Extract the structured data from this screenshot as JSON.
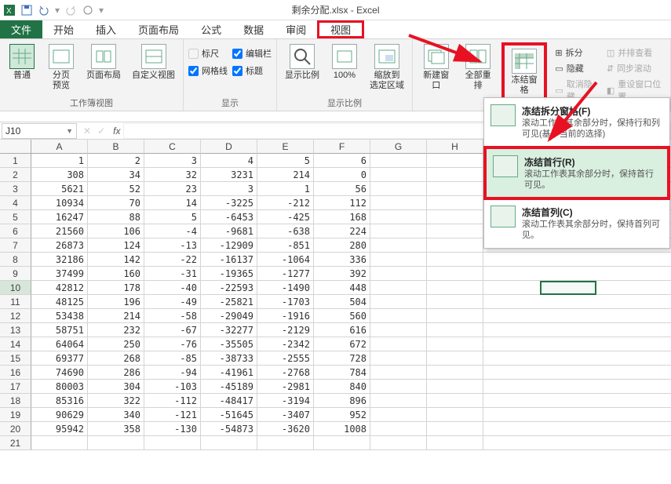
{
  "appTitle": "剩余分配.xlsx - Excel",
  "tabs": {
    "file": "文件",
    "home": "开始",
    "insert": "插入",
    "layout": "页面布局",
    "formula": "公式",
    "data": "数据",
    "review": "审阅",
    "view": "视图"
  },
  "ribbon": {
    "views": {
      "normal": "普通",
      "pagebreak": "分页\n预览",
      "pagelayout": "页面布局",
      "custom": "自定义视图",
      "groupLabel": "工作簿视图"
    },
    "show": {
      "ruler": "标尺",
      "formula": "编辑栏",
      "gridlines": "网格线",
      "headings": "标题",
      "groupLabel": "显示"
    },
    "zoom": {
      "zoom": "显示比例",
      "hundred": "100%",
      "zoomSel": "缩放到\n选定区域",
      "groupLabel": "显示比例"
    },
    "window": {
      "newWin": "新建窗口",
      "arrange": "全部重排",
      "freeze": "冻结窗格",
      "split": "拆分",
      "hide": "隐藏",
      "unhide": "取消隐藏",
      "sideBySide": "并排查看",
      "syncScroll": "同步滚动",
      "resetPos": "重设窗口位置"
    }
  },
  "freezeMenu": {
    "panes": {
      "title": "冻结拆分窗格(F)",
      "desc": "滚动工作表其余部分时，保持行和列可见(基于当前的选择)"
    },
    "topRow": {
      "title": "冻结首行(R)",
      "desc": "滚动工作表其余部分时，保持首行可见。"
    },
    "firstCol": {
      "title": "冻结首列(C)",
      "desc": "滚动工作表其余部分时，保持首列可见。"
    }
  },
  "nameBox": "J10",
  "columns": [
    "A",
    "B",
    "C",
    "D",
    "E",
    "F",
    "G",
    "H"
  ],
  "chart_data": {
    "type": "table",
    "columns": [
      "A",
      "B",
      "C",
      "D",
      "E",
      "F"
    ],
    "rows": [
      [
        1,
        2,
        3,
        4,
        5,
        6
      ],
      [
        308,
        34,
        32,
        3231,
        214,
        0
      ],
      [
        5621,
        52,
        23,
        3,
        1,
        56
      ],
      [
        10934,
        70,
        14,
        -3225,
        -212,
        112
      ],
      [
        16247,
        88,
        5,
        -6453,
        -425,
        168
      ],
      [
        21560,
        106,
        -4,
        -9681,
        -638,
        224
      ],
      [
        26873,
        124,
        -13,
        -12909,
        -851,
        280
      ],
      [
        32186,
        142,
        -22,
        -16137,
        -1064,
        336
      ],
      [
        37499,
        160,
        -31,
        -19365,
        -1277,
        392
      ],
      [
        42812,
        178,
        -40,
        -22593,
        -1490,
        448
      ],
      [
        48125,
        196,
        -49,
        -25821,
        -1703,
        504
      ],
      [
        53438,
        214,
        -58,
        -29049,
        -1916,
        560
      ],
      [
        58751,
        232,
        -67,
        -32277,
        -2129,
        616
      ],
      [
        64064,
        250,
        -76,
        -35505,
        -2342,
        672
      ],
      [
        69377,
        268,
        -85,
        -38733,
        -2555,
        728
      ],
      [
        74690,
        286,
        -94,
        -41961,
        -2768,
        784
      ],
      [
        80003,
        304,
        -103,
        -45189,
        -2981,
        840
      ],
      [
        85316,
        322,
        -112,
        -48417,
        -3194,
        896
      ],
      [
        90629,
        340,
        -121,
        -51645,
        -3407,
        952
      ],
      [
        95942,
        358,
        -130,
        -54873,
        -3620,
        1008
      ]
    ]
  }
}
